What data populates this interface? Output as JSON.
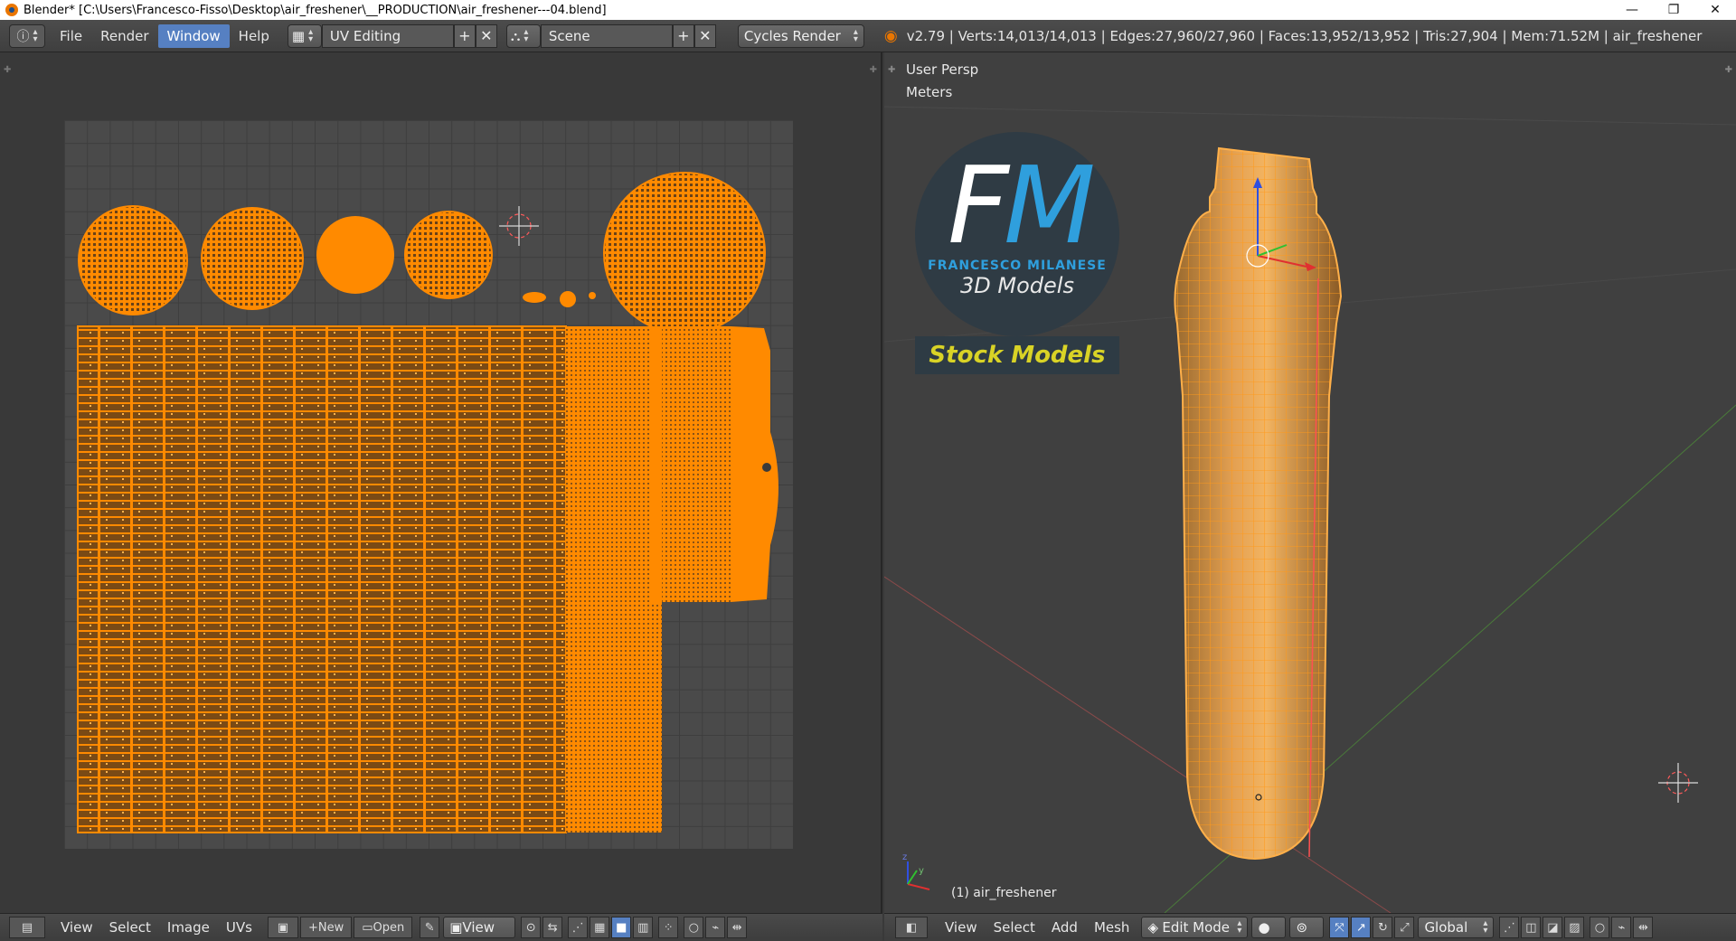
{
  "window": {
    "title": "Blender* [C:\\Users\\Francesco-Fisso\\Desktop\\air_freshener\\__PRODUCTION\\air_freshener---04.blend]",
    "minimize": "—",
    "restore": "❐",
    "close": "✕"
  },
  "topbar": {
    "menus": [
      "File",
      "Render",
      "Window",
      "Help"
    ],
    "active_menu": "Window",
    "screen_layout": "UV Editing",
    "scene": "Scene",
    "render_engine": "Cycles Render",
    "stats": "v2.79 | Verts:14,013/14,013 | Edges:27,960/27,960 | Faces:13,952/13,952 | Tris:27,904 | Mem:71.52M | air_freshener"
  },
  "viewport": {
    "view_name": "User Persp",
    "units": "Meters",
    "object_label": "(1) air_freshener"
  },
  "logo": {
    "letter_f": "F",
    "letter_m": "M",
    "name": "FRANCESCO MILANESE",
    "subtitle": "3D Models",
    "banner": "Stock Models"
  },
  "uv_editor_header": {
    "menus": [
      "View",
      "Select",
      "Image",
      "UVs"
    ],
    "new_label": "New",
    "open_label": "Open",
    "view_label": "View"
  },
  "view3d_header": {
    "menus": [
      "View",
      "Select",
      "Add",
      "Mesh"
    ],
    "mode": "Edit Mode",
    "orientation": "Global"
  },
  "colors": {
    "accent": "#5680c2",
    "uv_orange": "#ff8a00",
    "background": "#393939"
  }
}
